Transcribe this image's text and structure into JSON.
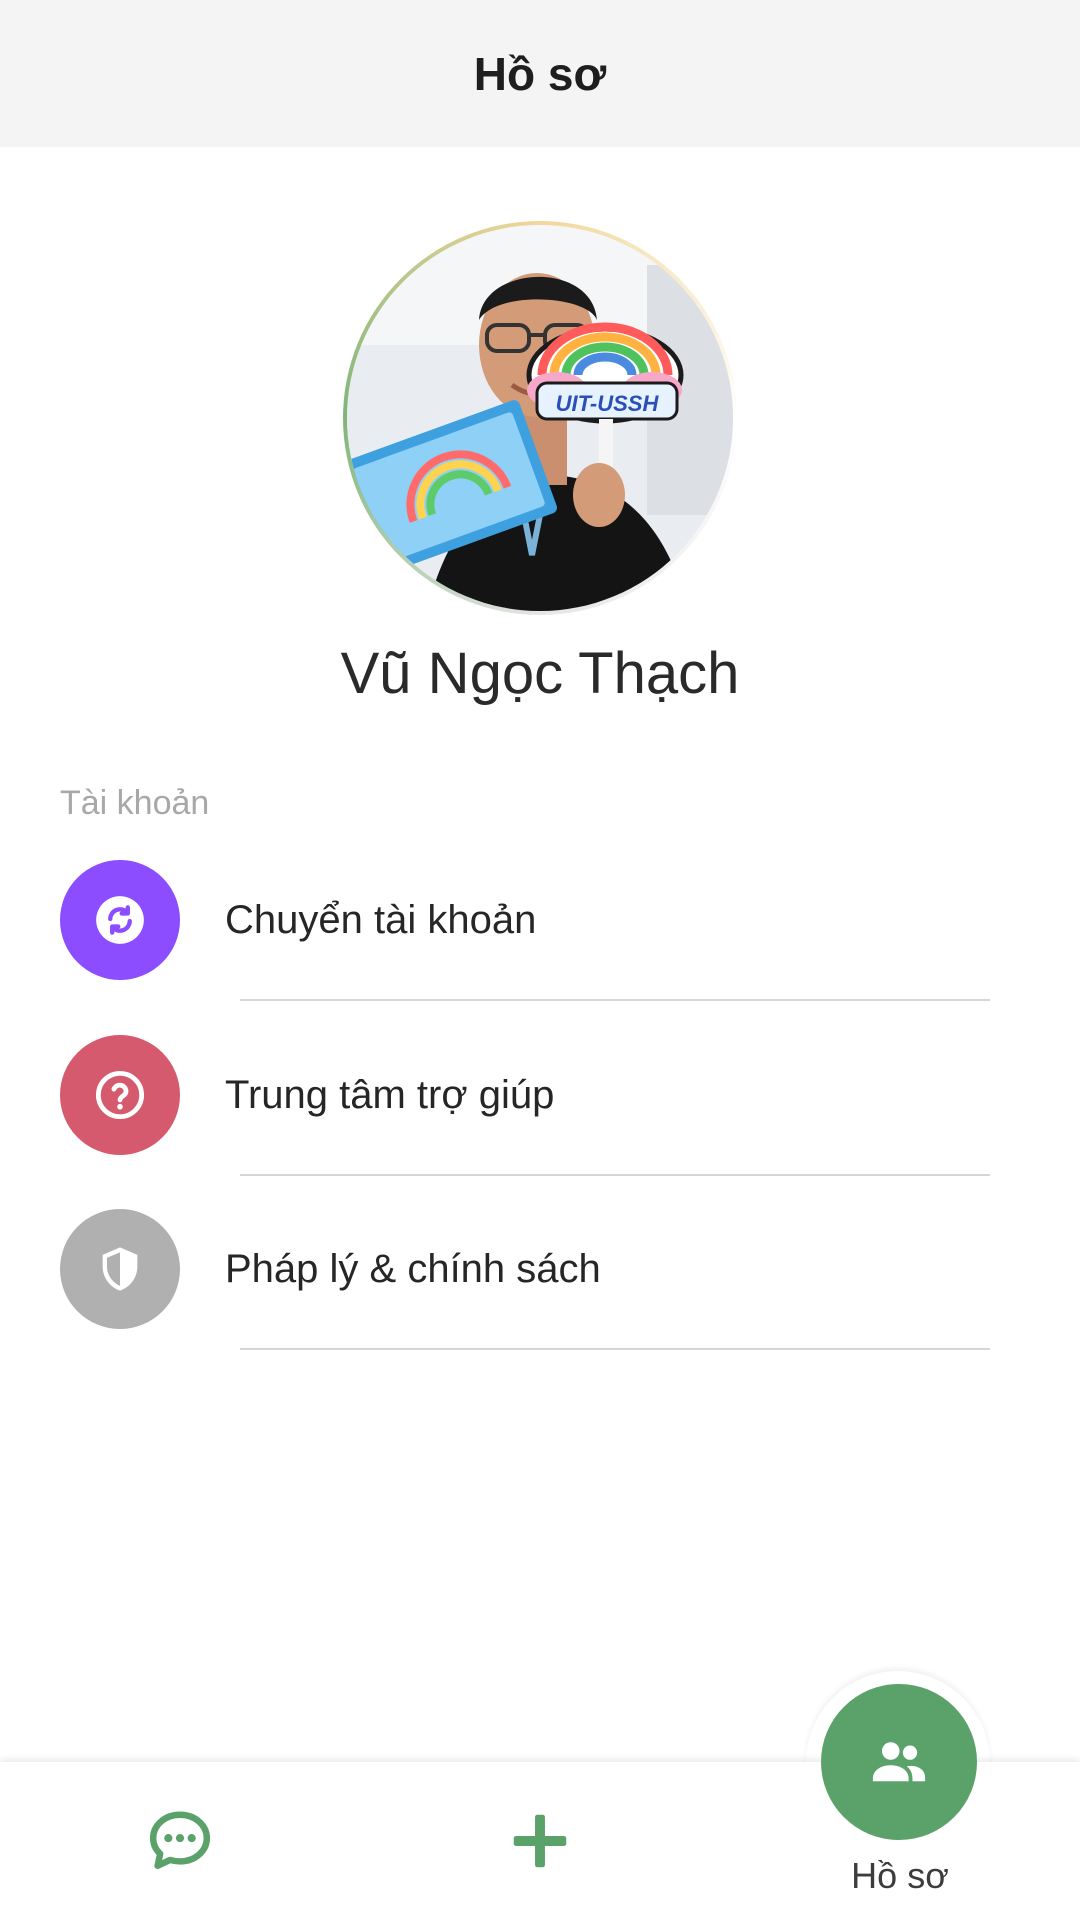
{
  "header": {
    "title": "Hồ sơ"
  },
  "profile": {
    "name": "Vũ Ngọc Thạch",
    "avatar_badge": "UIT-USSH"
  },
  "section": {
    "label": "Tài khoản"
  },
  "menu": {
    "items": [
      {
        "label": "Chuyển tài khoản",
        "icon": "switch-account-icon",
        "color": "#8b4dff"
      },
      {
        "label": "Trung tâm trợ giúp",
        "icon": "help-circle-icon",
        "color": "#d65a6e"
      },
      {
        "label": "Pháp lý & chính sách",
        "icon": "shield-icon",
        "color": "#b0b0b0"
      }
    ]
  },
  "bottom_nav": {
    "items": [
      {
        "icon": "chat-bubble-icon"
      },
      {
        "icon": "plus-icon"
      },
      {
        "icon": "people-icon",
        "label": "Hồ sơ",
        "active": true
      }
    ]
  },
  "colors": {
    "accent": "#5aa16a",
    "header_bg": "#f4f4f4"
  }
}
